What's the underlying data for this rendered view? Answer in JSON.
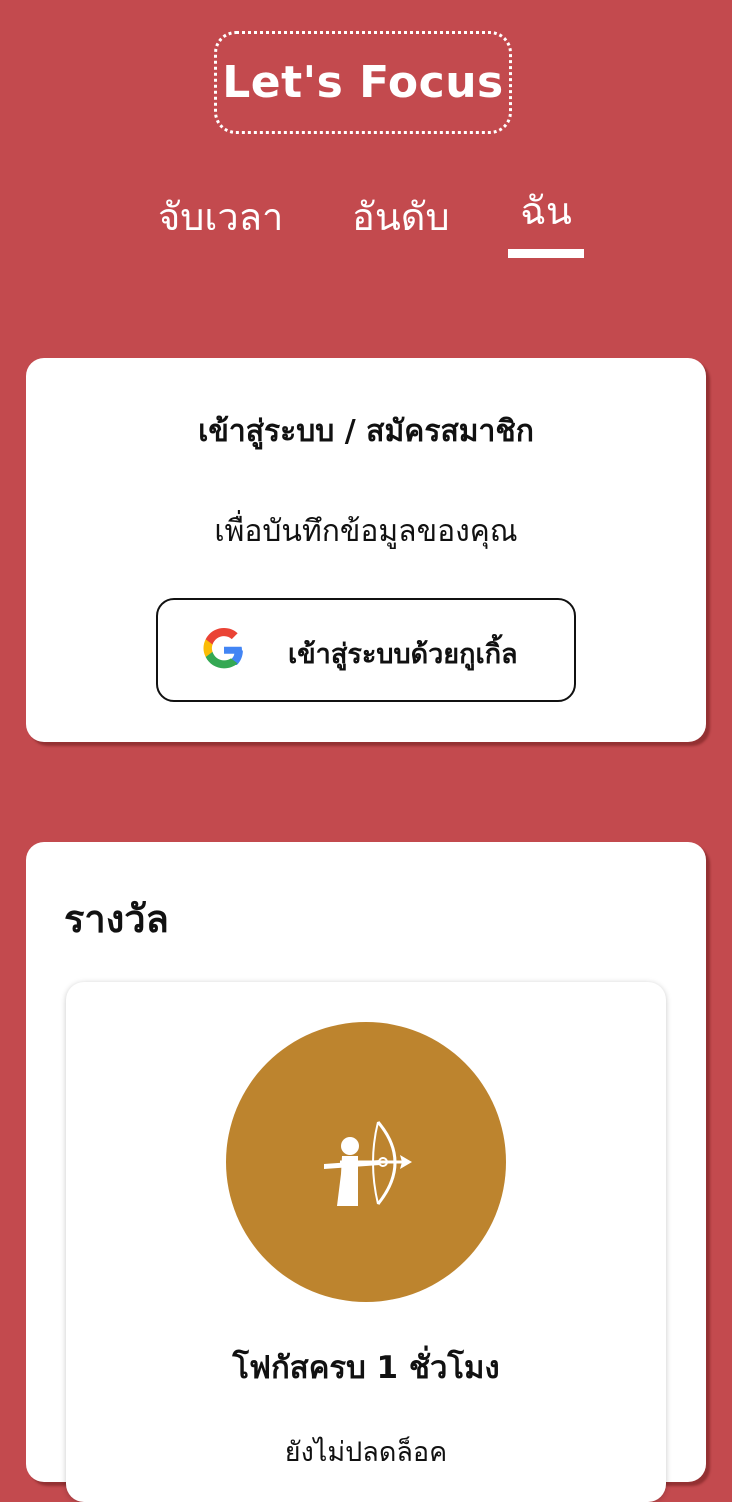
{
  "app": {
    "logo_text": "Let's Focus"
  },
  "tabs": [
    {
      "label": "จับเวลา",
      "active": false
    },
    {
      "label": "อันดับ",
      "active": false
    },
    {
      "label": "ฉัน",
      "active": true
    }
  ],
  "login_card": {
    "title": "เข้าสู่ระบบ / สมัครสมาชิก",
    "subtitle": "เพื่อบันทึกข้อมูลของคุณ",
    "google_button_label": "เข้าสู่ระบบด้วยกูเกิ้ล",
    "google_icon": "google-g-icon"
  },
  "rewards": {
    "title": "รางวัล",
    "items": [
      {
        "name": "โฟกัสครบ 1 ชั่วโมง",
        "status": "ยังไม่ปลดล็อค",
        "icon": "archer-icon",
        "badge_color": "#bd842e"
      }
    ]
  },
  "colors": {
    "background": "#c34a4e",
    "card": "#ffffff",
    "text": "#111111",
    "badge": "#bd842e"
  }
}
